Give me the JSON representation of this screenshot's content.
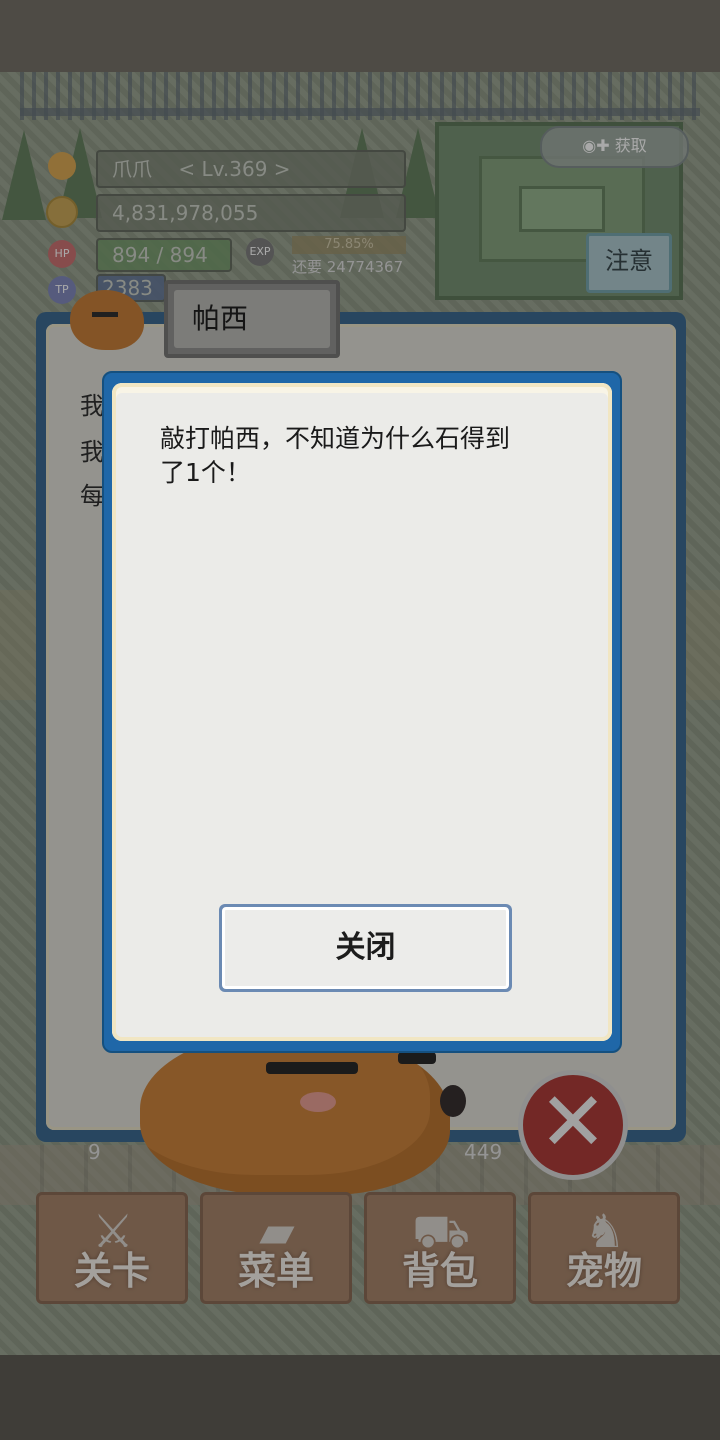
{
  "hud": {
    "player_name": "爪爪",
    "level": "< Lv.369 >",
    "gold": "4,831,978,055",
    "hp_label": "HP",
    "hp": "894 / 894",
    "exp_label": "EXP",
    "exp_percent": "75.85%",
    "exp_remaining": "还要 24774367",
    "tp_label": "TP",
    "tp": "2383",
    "notice_button": "注意",
    "gift_button": "获取"
  },
  "back_dialog": {
    "speaker": "帕西",
    "lines": [
      "我",
      "我",
      "每"
    ]
  },
  "scene_stats": {
    "left_value": "9",
    "right_value": "449"
  },
  "nav": {
    "items": [
      {
        "label": "关卡",
        "icon": "crossed-swords-icon"
      },
      {
        "label": "菜单",
        "icon": "book-icon"
      },
      {
        "label": "背包",
        "icon": "backpack-icon"
      },
      {
        "label": "宠物",
        "icon": "dragon-icon"
      }
    ]
  },
  "popup": {
    "message_line1": "敲打帕西，不知道为什么石得到",
    "message_line2": "了1个！",
    "close_label": "关闭"
  },
  "colors": {
    "dialog_border": "#1f67a8",
    "paper": "#ebebe8",
    "close_x": "#a92f2c",
    "nav_button": "#a27d62"
  }
}
